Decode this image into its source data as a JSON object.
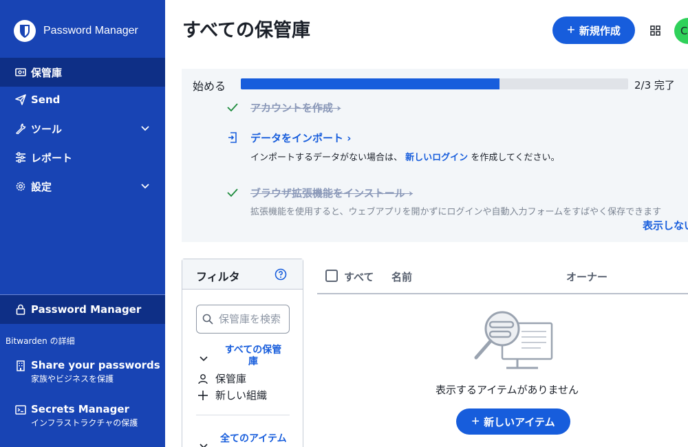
{
  "app": {
    "brand": "Password Manager"
  },
  "sidebar": {
    "nav": [
      {
        "label": "保管庫",
        "icon": "vault-icon",
        "active": true
      },
      {
        "label": "Send",
        "icon": "send-icon"
      },
      {
        "label": "ツール",
        "icon": "wrench-icon",
        "expandable": true
      },
      {
        "label": "レポート",
        "icon": "sliders-icon"
      },
      {
        "label": "設定",
        "icon": "gear-icon",
        "expandable": true
      }
    ],
    "product_switch": "Password Manager",
    "more_title": "Bitwarden の詳細",
    "promos": [
      {
        "title": "Share your passwords",
        "subtitle": "家族やビジネスを保護",
        "icon": "building-icon"
      },
      {
        "title": "Secrets Manager",
        "subtitle": "インフラストラクチャの保護",
        "icon": "terminal-icon"
      }
    ]
  },
  "header": {
    "title": "すべての保管庫",
    "new_button": "新規作成",
    "avatar_initial": "C"
  },
  "getting_started": {
    "label": "始める",
    "progress_text": "2/3 完了",
    "progress_fraction": 0.667,
    "steps": [
      {
        "title": "アカウントを作成",
        "done": true
      },
      {
        "title": "データをインポート",
        "done": false,
        "desc_before": "インポートするデータがない場合は、",
        "desc_link": "新しいログイン",
        "desc_after": "を作成してください。"
      },
      {
        "title": "ブラウザ拡張機能をインストール",
        "done": true,
        "desc": "拡張機能を使用すると、ウェブアプリを開かずにログインや自動入力フォームをすばやく保存できます"
      }
    ],
    "hide_link": "表示しない"
  },
  "filter": {
    "title": "フィルタ",
    "search_placeholder": "保管庫を検索",
    "all_vaults": "すべての保管庫",
    "items": [
      "保管庫",
      "新しい組織"
    ],
    "all_items": "全てのアイテム"
  },
  "table": {
    "select_all": "すべて",
    "col_name": "名前",
    "col_owner": "オーナー",
    "empty_text": "表示するアイテムがありません",
    "new_item_button": "新しいアイテム"
  },
  "colors": {
    "sidebar": "#1844b4",
    "sidebar_active": "#0e2f86",
    "accent": "#175ddc",
    "avatar": "#2fd15a"
  }
}
